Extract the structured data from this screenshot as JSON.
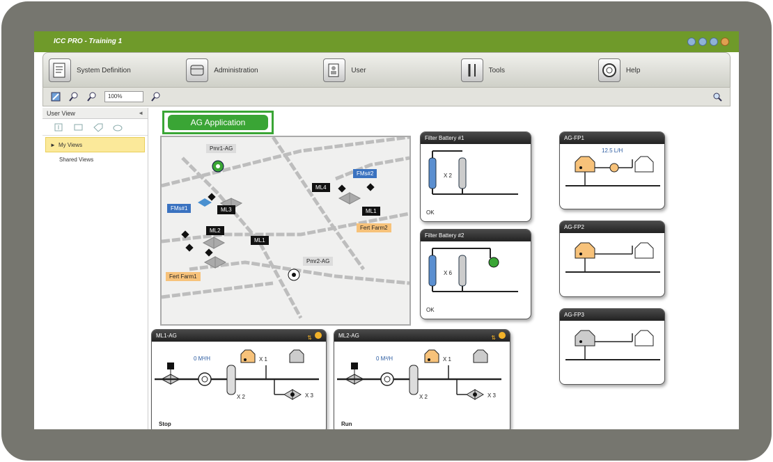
{
  "app": {
    "title": "ICC PRO - Training 1"
  },
  "menu": [
    {
      "label": "System Definition",
      "icon": "system-definition-icon"
    },
    {
      "label": "Administration",
      "icon": "administration-icon"
    },
    {
      "label": "User",
      "icon": "user-icon"
    },
    {
      "label": "Tools",
      "icon": "tools-icon"
    },
    {
      "label": "Help",
      "icon": "help-icon"
    }
  ],
  "toolbar": {
    "zoom": "100%"
  },
  "sidebar": {
    "title": "User View",
    "items": [
      {
        "label": "My Views",
        "selected": true
      },
      {
        "label": "Shared Views",
        "selected": false
      }
    ]
  },
  "main": {
    "application_button": "AG Application",
    "map_labels": {
      "pmr1": "Pmr1-AG",
      "pmr2": "Pmr2-AG",
      "fmsm1": "FMs#1",
      "fmsm2": "FMs#2",
      "ml1a": "ML1",
      "ml1b": "ML1",
      "ml2": "ML2",
      "ml3": "ML3",
      "ml4": "ML4",
      "fert1": "Fert Farm1",
      "fert2": "Fert Farm2"
    },
    "filter1": {
      "title": "Filter Battery #1",
      "count": "X 2",
      "status": "OK"
    },
    "filter2": {
      "title": "Filter Battery #2",
      "count": "X 6",
      "status": "OK"
    },
    "fp1": {
      "title": "AG-FP1",
      "flow": "12.5 L/H"
    },
    "fp2": {
      "title": "AG-FP2"
    },
    "fp3": {
      "title": "AG-FP3"
    },
    "ml1": {
      "title": "ML1-AG",
      "flow": "0 M³/H",
      "x1": "X 1",
      "x2": "X 2",
      "x3": "X 3",
      "status": "Stop"
    },
    "ml2": {
      "title": "ML2-AG",
      "flow": "0 M³/H",
      "x1": "X 1",
      "x2": "X 2",
      "x3": "X 3",
      "status": "Run"
    }
  },
  "colors": {
    "brand_green": "#6f9a2a",
    "app_green": "#3aa535",
    "tank_orange": "#f7c27a",
    "label_blue": "#3a72c0"
  }
}
